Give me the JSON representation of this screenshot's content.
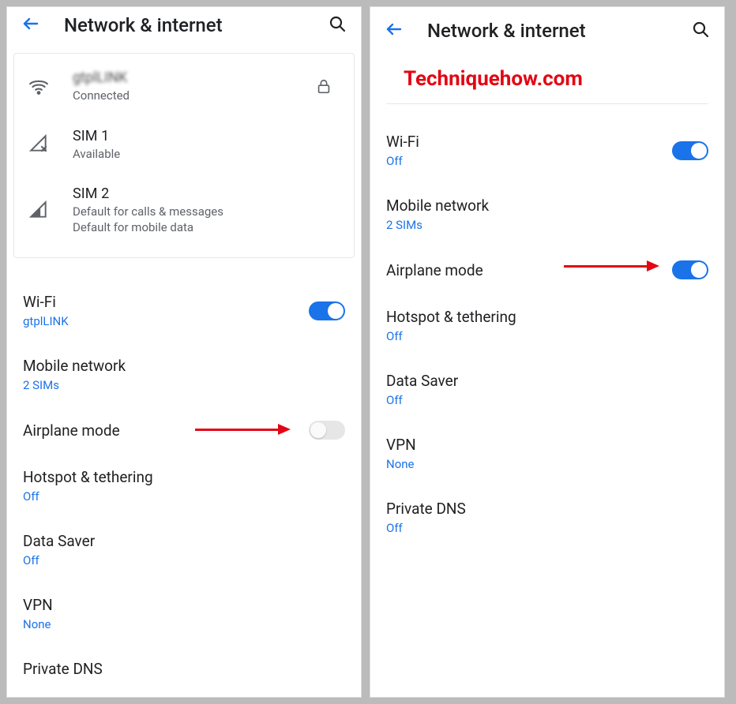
{
  "left": {
    "title": "Network & internet",
    "card": {
      "wifi": {
        "name": "gtplLINK",
        "status": "Connected"
      },
      "sim1": {
        "title": "SIM 1",
        "status": "Available"
      },
      "sim2": {
        "title": "SIM 2",
        "line1": "Default for calls & messages",
        "line2": "Default for mobile data"
      }
    },
    "items": {
      "wifi": {
        "title": "Wi-Fi",
        "sub": "gtplLINK"
      },
      "mobile": {
        "title": "Mobile network",
        "sub": "2 SIMs"
      },
      "airplane": {
        "title": "Airplane mode"
      },
      "hotspot": {
        "title": "Hotspot & tethering",
        "sub": "Off"
      },
      "datasaver": {
        "title": "Data Saver",
        "sub": "Off"
      },
      "vpn": {
        "title": "VPN",
        "sub": "None"
      },
      "privatedns": {
        "title": "Private DNS"
      }
    }
  },
  "right": {
    "title": "Network & internet",
    "watermark": "Techniquehow.com",
    "items": {
      "wifi": {
        "title": "Wi-Fi",
        "sub": "Off"
      },
      "mobile": {
        "title": "Mobile network",
        "sub": "2 SIMs"
      },
      "airplane": {
        "title": "Airplane mode"
      },
      "hotspot": {
        "title": "Hotspot & tethering",
        "sub": "Off"
      },
      "datasaver": {
        "title": "Data Saver",
        "sub": "Off"
      },
      "vpn": {
        "title": "VPN",
        "sub": "None"
      },
      "privatedns": {
        "title": "Private DNS",
        "sub": "Off"
      }
    }
  }
}
